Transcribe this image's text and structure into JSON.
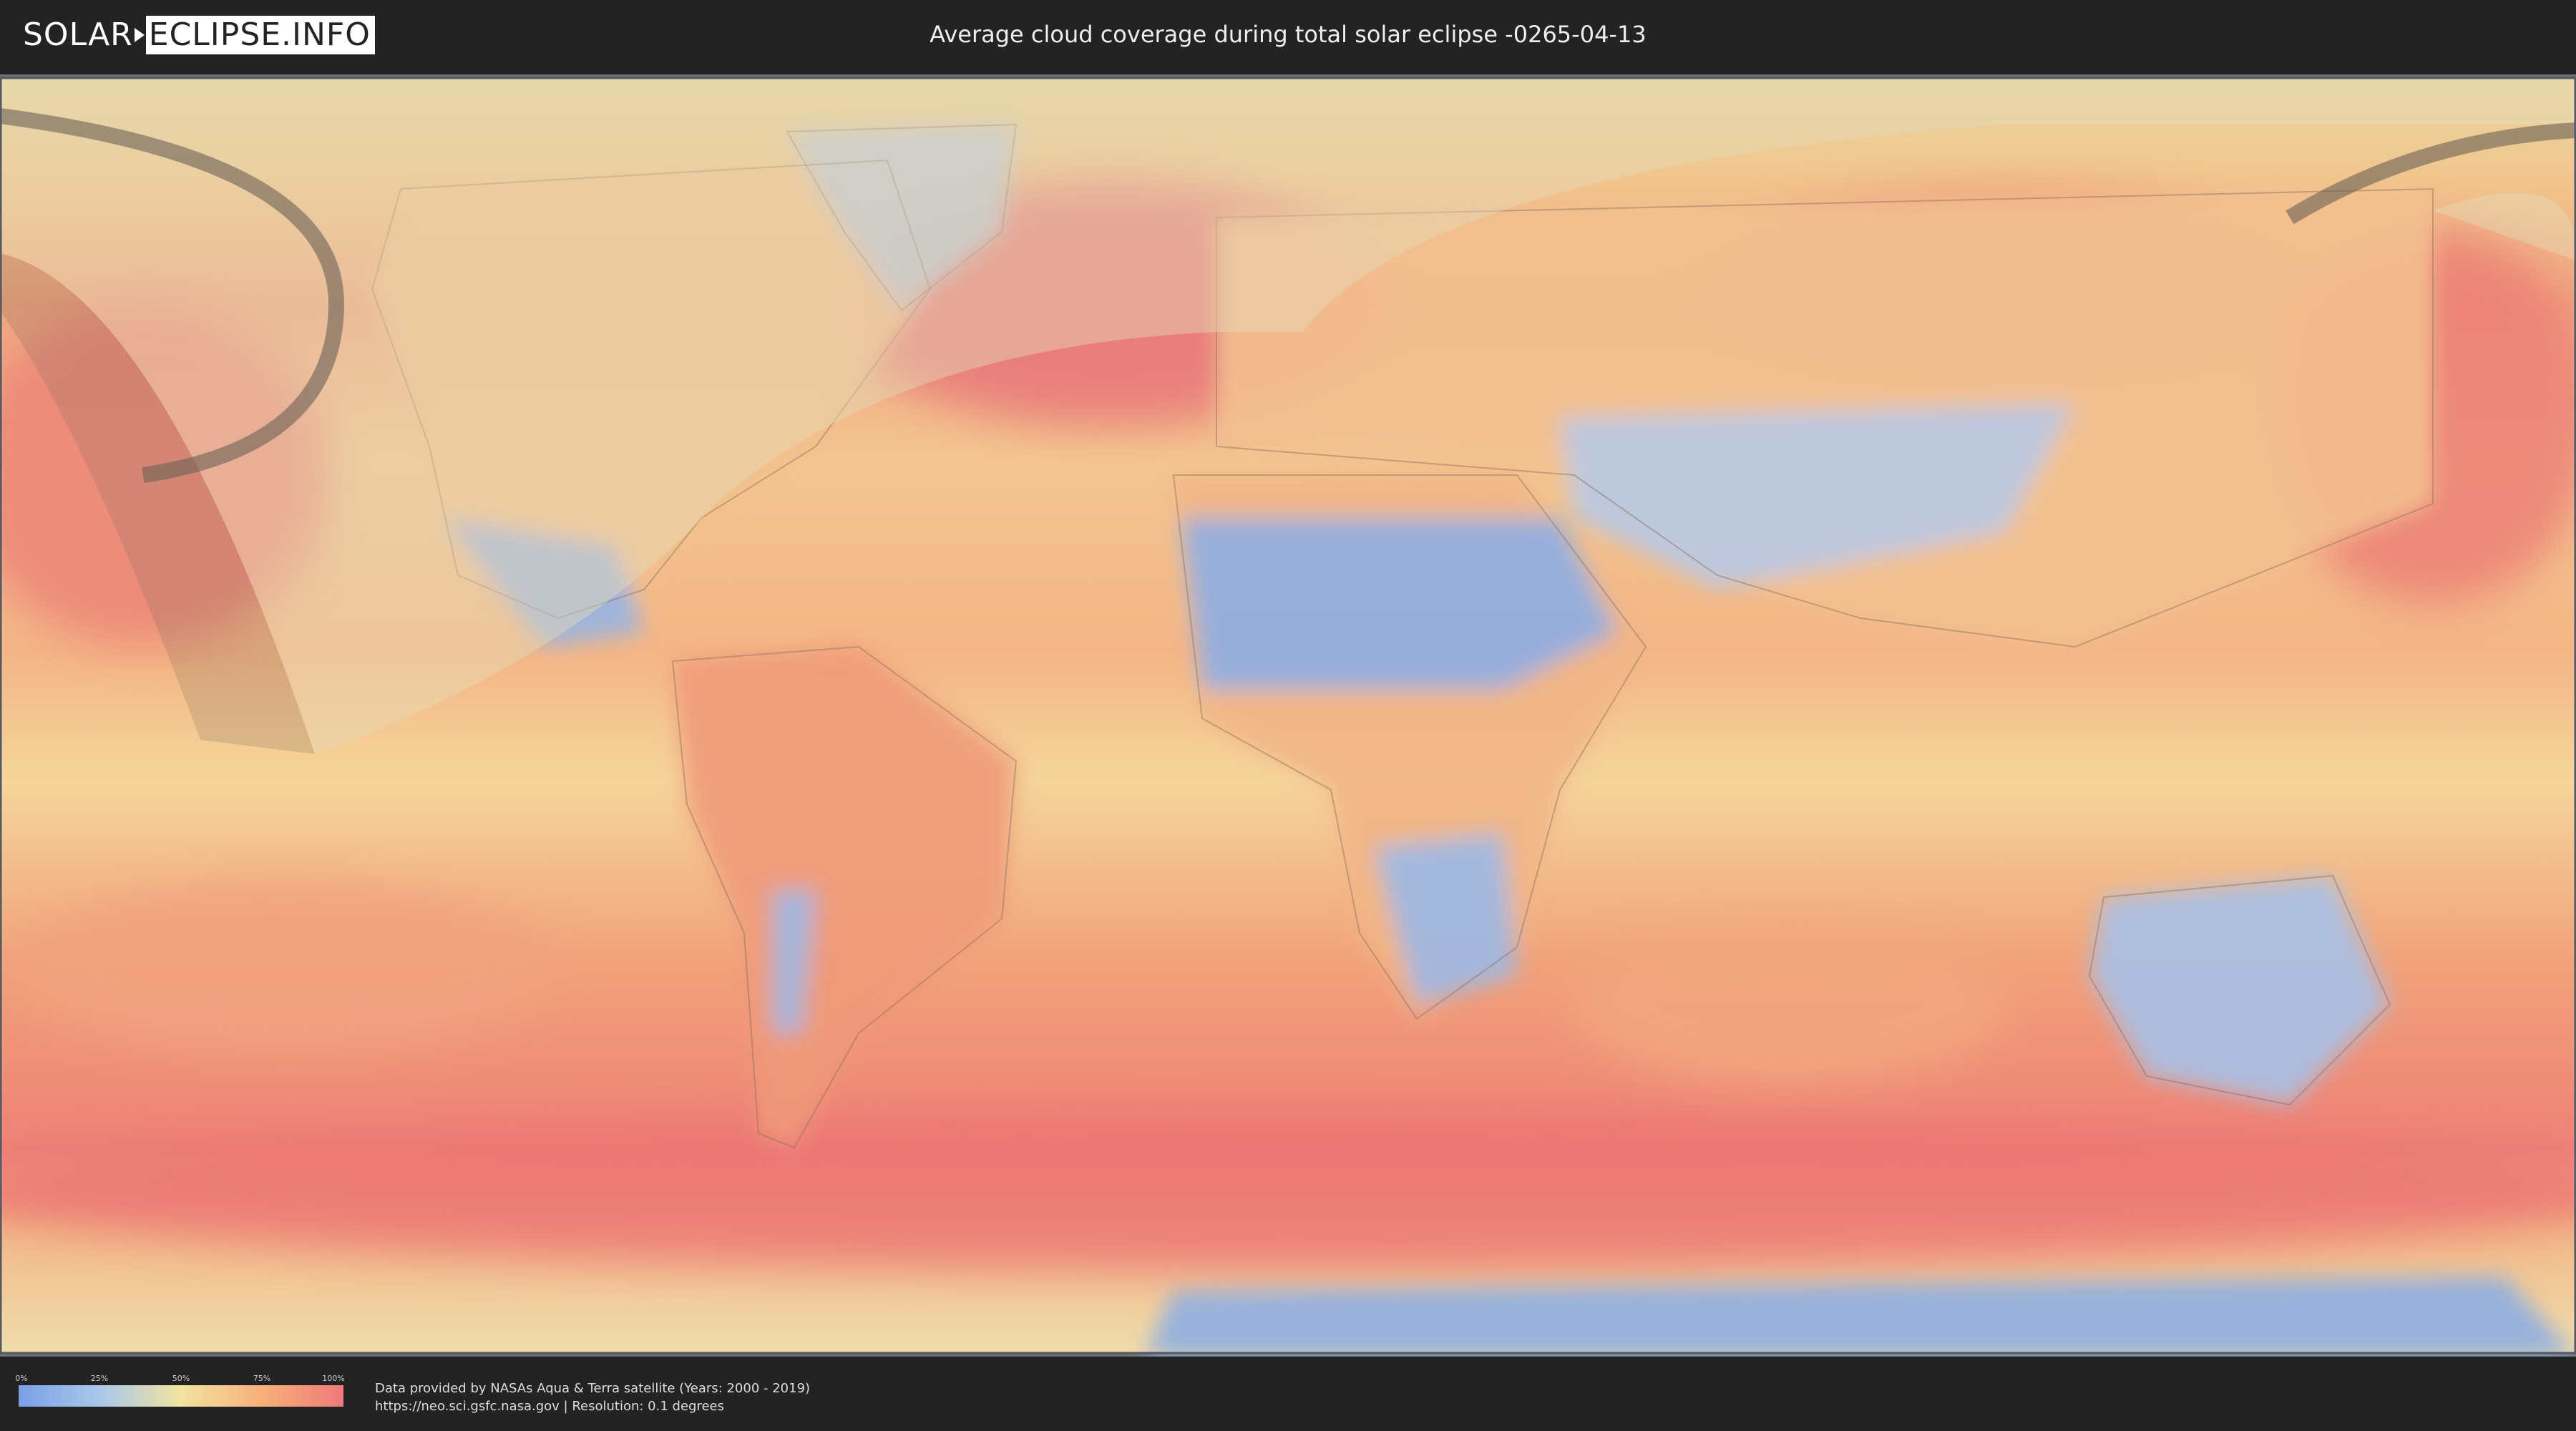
{
  "header": {
    "logo_part1": "SOLAR",
    "logo_part2": "ECLIPSE.INFO",
    "title": "Average cloud coverage during total solar eclipse -0265-04-13"
  },
  "legend": {
    "ticks": [
      "0%",
      "25%",
      "50%",
      "75%",
      "100%"
    ],
    "colors": [
      "#7aa0e6",
      "#a8c8ea",
      "#f3e3a0",
      "#f7b07a",
      "#ee7a7a"
    ]
  },
  "credits": {
    "line1": "Data provided by NASAs Aqua & Terra satellite (Years: 2000 - 2019)",
    "line2": "https://neo.sci.gsfc.nasa.gov | Resolution: 0.1 degrees"
  }
}
